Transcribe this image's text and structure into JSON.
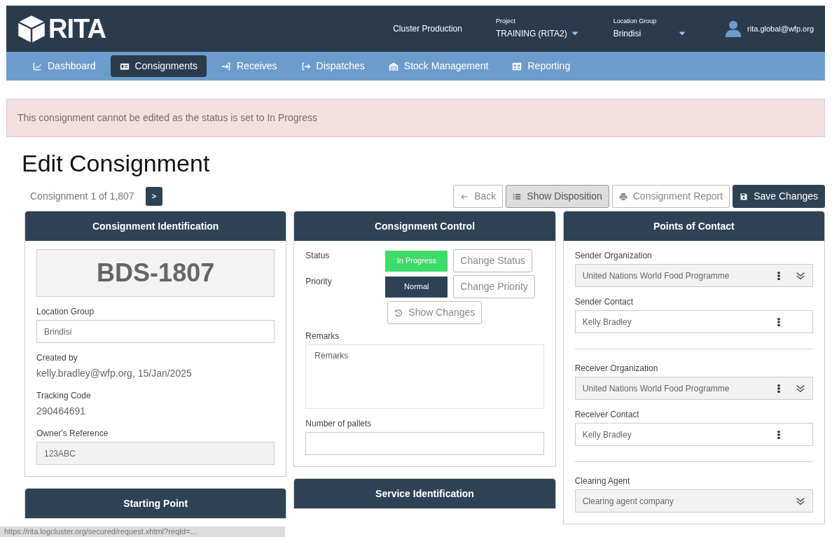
{
  "header": {
    "logo": "RITA",
    "cluster": "Cluster Production",
    "project": {
      "label": "Project",
      "value": "TRAINING (RITA2)"
    },
    "location_group": {
      "label": "Location Group",
      "value": "Brindisi"
    },
    "user": "rita.global@wfp.org"
  },
  "nav": [
    {
      "label": "Dashboard",
      "selected": false
    },
    {
      "label": "Consignments",
      "selected": true
    },
    {
      "label": "Receives",
      "selected": false
    },
    {
      "label": "Dispatches",
      "selected": false
    },
    {
      "label": "Stock Management",
      "selected": false
    },
    {
      "label": "Reporting",
      "selected": false
    }
  ],
  "alert": "This consignment cannot be edited as the status is set to In Progress",
  "title": "Edit Consignment",
  "pager": {
    "text": "Consignment 1 of 1,807",
    "next": ">"
  },
  "actions": [
    {
      "label": "Back",
      "kind": "outline",
      "hovered": false
    },
    {
      "label": "Show Disposition",
      "kind": "outline",
      "hovered": true
    },
    {
      "label": "Consignment Report",
      "kind": "outline",
      "hovered": false
    },
    {
      "label": "Save Changes",
      "kind": "dark",
      "hovered": false
    }
  ],
  "identification": {
    "title": "Consignment Identification",
    "code": "BDS-1807",
    "fields": [
      {
        "label": "Location Group",
        "value": "Brindisi",
        "kind": "input",
        "readonly": false
      },
      {
        "label": "Created by",
        "value": "kelly.bradley@wfp.org, 15/Jan/2025",
        "kind": "text"
      },
      {
        "label": "Tracking Code",
        "value": "290464691",
        "kind": "text"
      },
      {
        "label": "Owner's Reference",
        "value": "123ABC",
        "kind": "input",
        "readonly": true
      }
    ]
  },
  "control": {
    "title": "Consignment Control",
    "rows": [
      {
        "label": "Status",
        "value": "In Progress",
        "color": "#3ddc6b",
        "action": "Change Status"
      },
      {
        "label": "Priority",
        "value": "Normal",
        "color": "#2e4256",
        "action": "Change Priority"
      }
    ],
    "show_changes": "Show Changes",
    "remarks": {
      "label": "Remarks",
      "placeholder": "Remarks"
    },
    "pallets": {
      "label": "Number of pallets"
    }
  },
  "contacts": {
    "title": "Points of Contact",
    "groups": [
      [
        {
          "label": "Sender Organization",
          "value": "United Nations World Food Programme",
          "kind": "select"
        },
        {
          "label": "Sender Contact",
          "value": "Kelly Bradley",
          "kind": "lookup"
        }
      ],
      [
        {
          "label": "Receiver Organization",
          "value": "United Nations World Food Programme",
          "kind": "select"
        },
        {
          "label": "Receiver Contact",
          "value": "Kelly Bradley",
          "kind": "lookup"
        }
      ],
      [
        {
          "label": "Clearing Agent",
          "value": "Clearing agent company",
          "kind": "select-plain"
        }
      ]
    ]
  },
  "lower_panels": [
    "Starting Point",
    "Service Identification"
  ],
  "status_bar": "https://rita.logcluster.org/secured/request.xhtml?reqId=..."
}
